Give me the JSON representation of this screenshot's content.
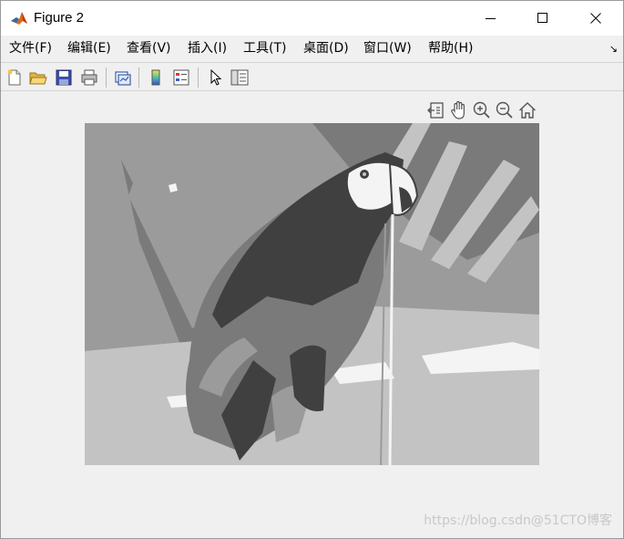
{
  "window": {
    "title": "Figure 2",
    "controls": {
      "minimize": "minimize-icon",
      "maximize": "maximize-icon",
      "close": "close-icon"
    }
  },
  "menubar": {
    "items": [
      {
        "label": "文件(F)"
      },
      {
        "label": "编辑(E)"
      },
      {
        "label": "查看(V)"
      },
      {
        "label": "插入(I)"
      },
      {
        "label": "工具(T)"
      },
      {
        "label": "桌面(D)"
      },
      {
        "label": "窗口(W)"
      },
      {
        "label": "帮助(H)"
      }
    ],
    "overflow_arrow": "↘"
  },
  "toolbar": {
    "buttons": [
      "new-figure-icon",
      "open-file-icon",
      "save-icon",
      "print-icon",
      "link-plot-icon",
      "colorbar-icon",
      "legend-icon",
      "edit-plot-cursor-icon",
      "property-inspector-icon"
    ]
  },
  "axes_toolbar": {
    "buttons": [
      "export-icon",
      "pan-hand-icon",
      "zoom-in-icon",
      "zoom-out-icon",
      "home-icon"
    ]
  },
  "figure": {
    "content": "grayscale quantized image of a parrot perched on a branch"
  },
  "watermark": "https://blog.csdn@51CTO博客",
  "colors": {
    "titlebar_bg": "#ffffff",
    "window_bg": "#f0f0f0",
    "gray_levels": [
      "#404040",
      "#7a7a7a",
      "#9b9b9b",
      "#c3c3c3",
      "#f4f4f4"
    ]
  }
}
